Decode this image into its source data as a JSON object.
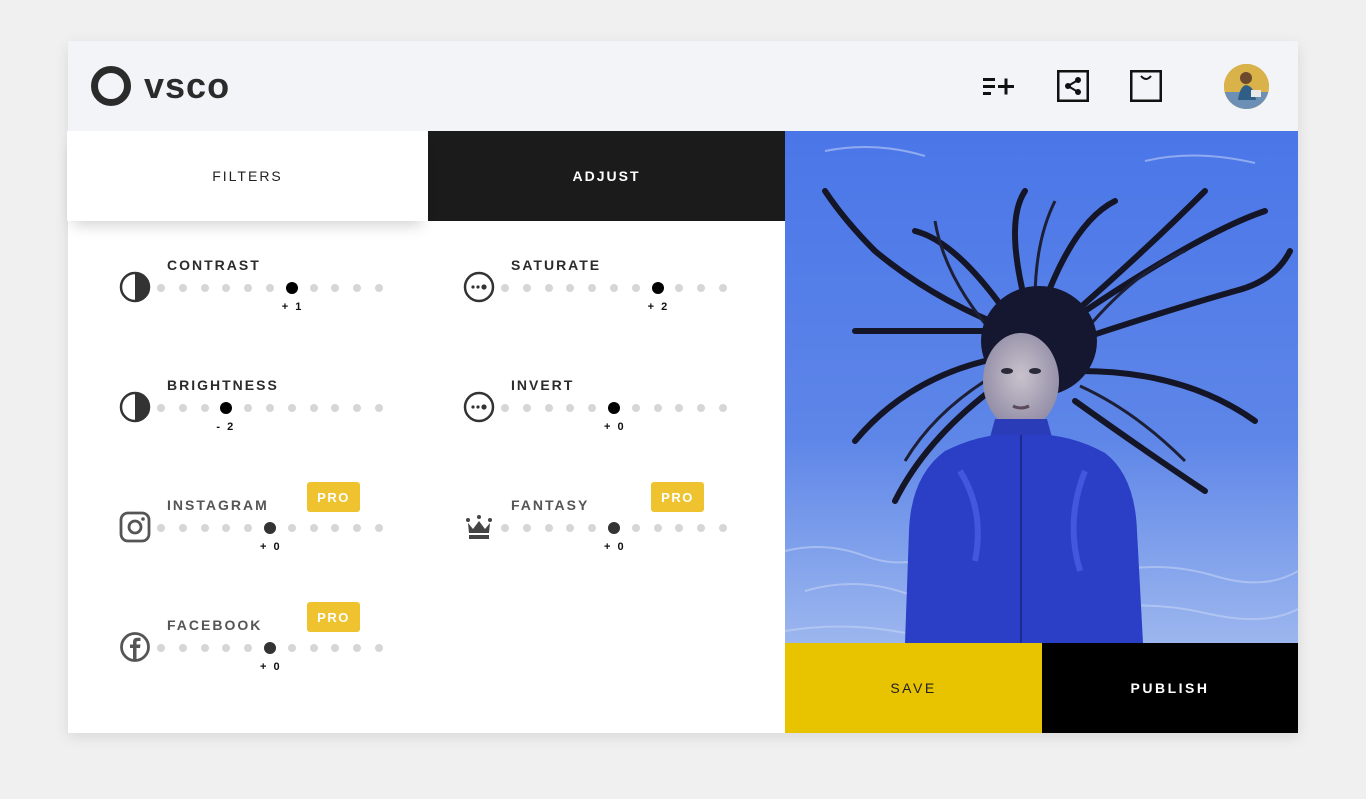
{
  "brand": {
    "name": "vsco"
  },
  "header": {
    "icons": [
      "playlist-add-icon",
      "share-icon",
      "shopping-bag-icon"
    ],
    "avatar": "user-avatar"
  },
  "tabs": [
    {
      "label": "FILTERS",
      "active": false
    },
    {
      "label": "ADJUST",
      "active": true
    }
  ],
  "adjustments": [
    {
      "label": "CONTRAST",
      "value": "+ 1",
      "level_index": 6,
      "steps": 11,
      "icon": "contrast-icon",
      "pro": false
    },
    {
      "label": "SATURATE",
      "value": "+ 2",
      "level_index": 7,
      "steps": 11,
      "icon": "saturate-icon",
      "pro": false
    },
    {
      "label": "BRIGHTNESS",
      "value": "- 2",
      "level_index": 3,
      "steps": 11,
      "icon": "brightness-icon",
      "pro": false
    },
    {
      "label": "INVERT",
      "value": "+ 0",
      "level_index": 5,
      "steps": 11,
      "icon": "invert-icon",
      "pro": false
    },
    {
      "label": "INSTAGRAM",
      "value": "+ 0",
      "level_index": 5,
      "steps": 11,
      "icon": "instagram-icon",
      "pro": true,
      "pro_label": "PRO"
    },
    {
      "label": "FANTASY",
      "value": "+ 0",
      "level_index": 5,
      "steps": 11,
      "icon": "crown-icon",
      "pro": true,
      "pro_label": "PRO"
    },
    {
      "label": "FACEBOOK",
      "value": "+ 0",
      "level_index": 5,
      "steps": 11,
      "icon": "facebook-icon",
      "pro": true,
      "pro_label": "PRO"
    }
  ],
  "actions": {
    "save": "SAVE",
    "publish": "PUBLISH"
  },
  "colors": {
    "accent_yellow": "#e8c300",
    "pro_badge": "#eec32f",
    "dark": "#1b1b1b"
  }
}
